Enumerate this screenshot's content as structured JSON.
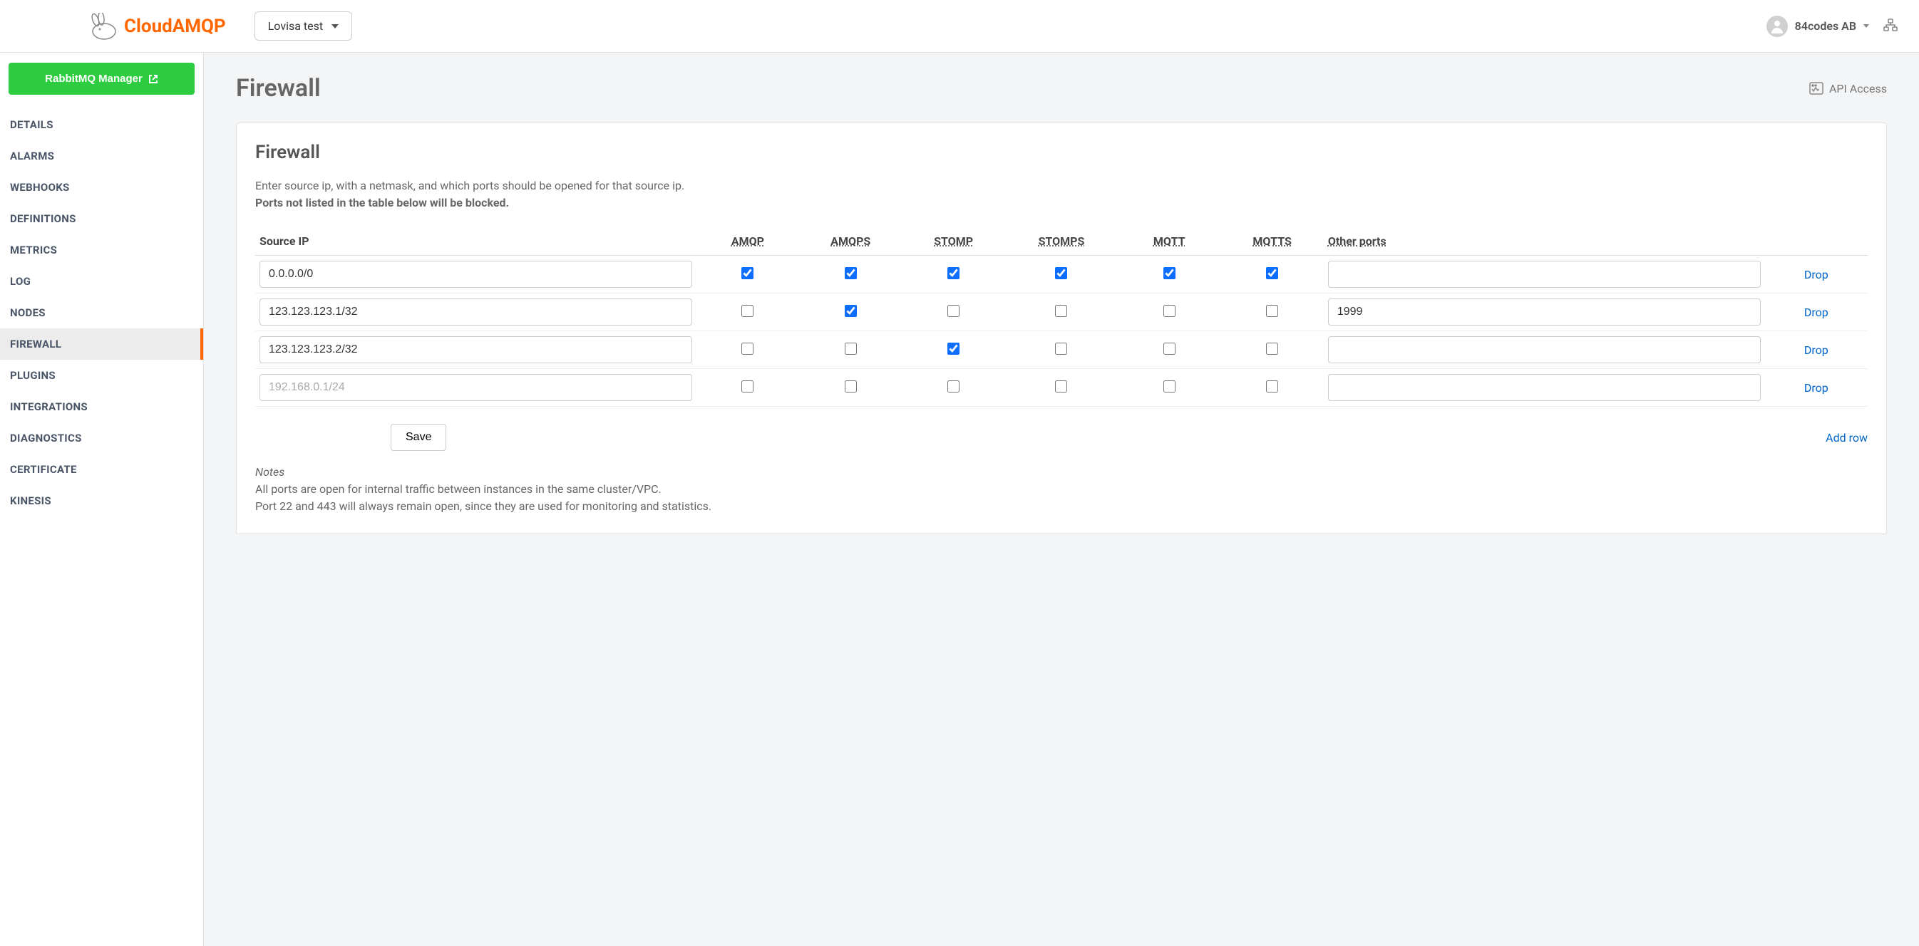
{
  "header": {
    "logo_text": "CloudAMQP",
    "instance_label": "Lovisa test",
    "account_label": "84codes AB"
  },
  "sidebar": {
    "rabbit_button": "RabbitMQ Manager",
    "items": [
      {
        "label": "DETAILS",
        "active": false
      },
      {
        "label": "ALARMS",
        "active": false
      },
      {
        "label": "WEBHOOKS",
        "active": false
      },
      {
        "label": "DEFINITIONS",
        "active": false
      },
      {
        "label": "METRICS",
        "active": false
      },
      {
        "label": "LOG",
        "active": false
      },
      {
        "label": "NODES",
        "active": false
      },
      {
        "label": "FIREWALL",
        "active": true
      },
      {
        "label": "PLUGINS",
        "active": false
      },
      {
        "label": "INTEGRATIONS",
        "active": false
      },
      {
        "label": "DIAGNOSTICS",
        "active": false
      },
      {
        "label": "CERTIFICATE",
        "active": false
      },
      {
        "label": "KINESIS",
        "active": false
      }
    ]
  },
  "page": {
    "title": "Firewall",
    "api_access": "API Access",
    "card_title": "Firewall",
    "desc_line1": "Enter source ip, with a netmask, and which ports should be opened for that source ip.",
    "desc_line2": "Ports not listed in the table below will be blocked.",
    "columns": {
      "source_ip": "Source IP",
      "amqp": "AMQP",
      "amqps": "AMQPS",
      "stomp": "STOMP",
      "stomps": "STOMPS",
      "mqtt": "MQTT",
      "mqtts": "MQTTS",
      "other": "Other ports"
    },
    "rows": [
      {
        "ip": "0.0.0.0/0",
        "amqp": true,
        "amqps": true,
        "stomp": true,
        "stomps": true,
        "mqtt": true,
        "mqtts": true,
        "other": ""
      },
      {
        "ip": "123.123.123.1/32",
        "amqp": false,
        "amqps": true,
        "stomp": false,
        "stomps": false,
        "mqtt": false,
        "mqtts": false,
        "other": "1999"
      },
      {
        "ip": "123.123.123.2/32",
        "amqp": false,
        "amqps": false,
        "stomp": true,
        "stomps": false,
        "mqtt": false,
        "mqtts": false,
        "other": ""
      },
      {
        "ip": "",
        "placeholder": "192.168.0.1/24",
        "amqp": false,
        "amqps": false,
        "stomp": false,
        "stomps": false,
        "mqtt": false,
        "mqtts": false,
        "other": ""
      }
    ],
    "drop_label": "Drop",
    "save_label": "Save",
    "add_row_label": "Add row",
    "notes_title": "Notes",
    "notes_line1": "All ports are open for internal traffic between instances in the same cluster/VPC.",
    "notes_line2": "Port 22 and 443 will always remain open, since they are used for monitoring and statistics."
  }
}
